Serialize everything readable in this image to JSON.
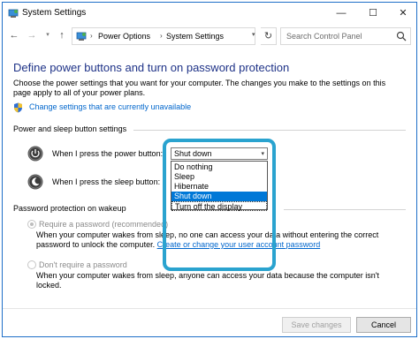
{
  "window": {
    "title": "System Settings",
    "min_glyph": "—",
    "max_glyph": "☐",
    "close_glyph": "✕"
  },
  "nav": {
    "back_glyph": "←",
    "forward_glyph": "→",
    "up_glyph": "↑",
    "refresh_glyph": "↻",
    "breadcrumb": [
      "Power Options",
      "System Settings"
    ],
    "search_placeholder": "Search Control Panel"
  },
  "page": {
    "heading": "Define power buttons and turn on password protection",
    "intro": "Choose the power settings that you want for your computer. The changes you make to the settings on this page apply to all of your power plans.",
    "change_link": "Change settings that are currently unavailable"
  },
  "power_section": {
    "title": "Power and sleep button settings",
    "power_label": "When I press the power button:",
    "sleep_label": "When I press the sleep button:",
    "power_value": "Shut down",
    "options": [
      "Do nothing",
      "Sleep",
      "Hibernate",
      "Shut down",
      "Turn off the display"
    ],
    "selected_index": 3
  },
  "password_section": {
    "title": "Password protection on wakeup",
    "require_label": "Require a password (recommended)",
    "require_desc_prefix": "When your computer wakes from sleep, no one can access your data without entering the correct password to unlock the computer.",
    "require_link": "Create or change your user account password",
    "dont_label": "Don't require a password",
    "dont_desc": "When your computer wakes from sleep, anyone can access your data because the computer isn't locked."
  },
  "footer": {
    "save_label": "Save changes",
    "cancel_label": "Cancel"
  },
  "colors": {
    "heading": "#1e3287",
    "link": "#0066cc",
    "highlight_ring": "#2aa3cf",
    "selected_option": "#0078d7"
  },
  "icons": [
    "control-panel-icon",
    "shield-icon",
    "power-button-icon",
    "sleep-button-icon",
    "search-icon"
  ]
}
